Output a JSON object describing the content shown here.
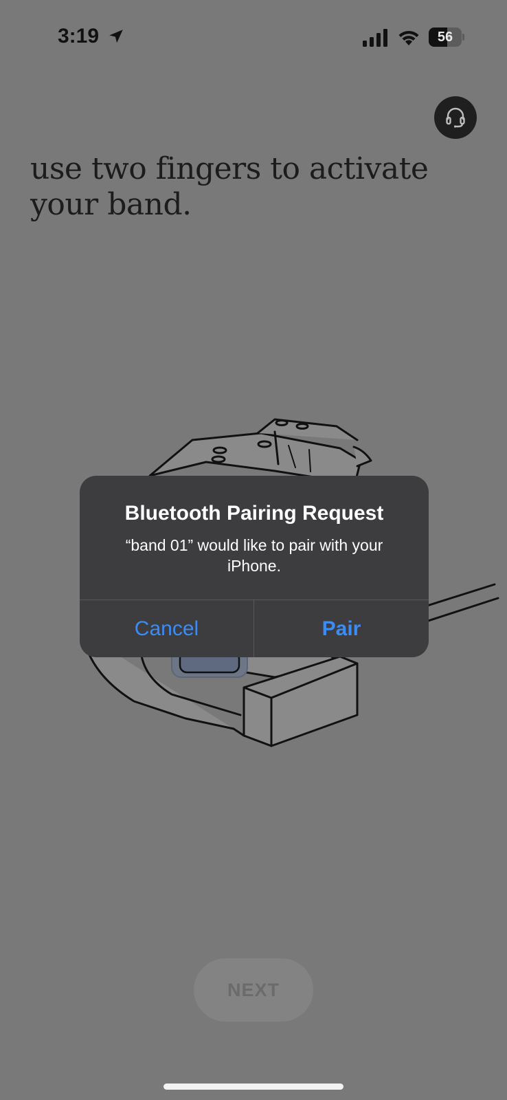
{
  "status_bar": {
    "time": "3:19",
    "battery": "56",
    "battery_level": 0.56,
    "icons": [
      "location-arrow-icon",
      "cellular-signal-icon",
      "wifi-icon",
      "battery-icon"
    ]
  },
  "header": {
    "support_icon": "headset-icon"
  },
  "instruction": {
    "headline": "use two fingers to activate your band."
  },
  "dialog": {
    "title": "Bluetooth Pairing Request",
    "message": "“band 01” would like to pair with your iPhone.",
    "cancel_label": "Cancel",
    "pair_label": "Pair"
  },
  "footer": {
    "next_label": "NEXT"
  },
  "colors": {
    "background": "#797979",
    "dialog_bg": "#3d3d3f",
    "dialog_button": "#3b8cf5",
    "support_button_bg": "#1f1f1f"
  }
}
